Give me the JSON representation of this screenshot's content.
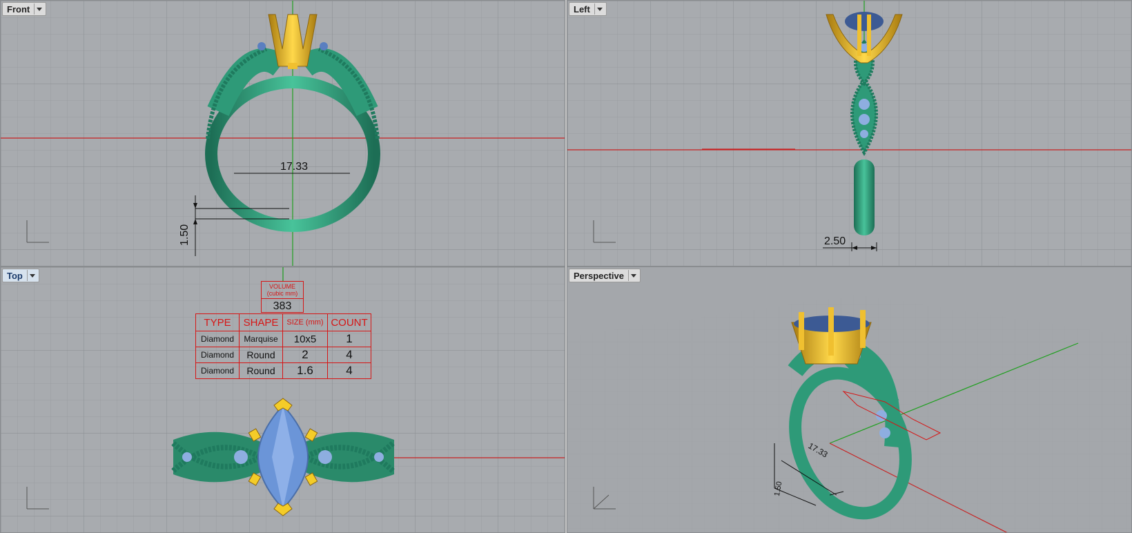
{
  "viewports": {
    "front": {
      "label": "Front"
    },
    "left": {
      "label": "Left"
    },
    "top": {
      "label": "Top"
    },
    "perspective": {
      "label": "Perspective"
    }
  },
  "dimensions": {
    "front_width": "17.33",
    "front_thickness": "1.50",
    "left_width": "2.50",
    "persp_width": "17.33",
    "persp_thickness": "1.50"
  },
  "stone_table": {
    "volume_title": "VOLUME",
    "volume_unit": "(cubic mm)",
    "volume_value": "383",
    "headers": [
      "TYPE",
      "SHAPE",
      "SIZE (mm)",
      "COUNT"
    ],
    "rows": [
      [
        "Diamond",
        "Marquise",
        "10x5",
        "1"
      ],
      [
        "Diamond",
        "Round",
        "2",
        "4"
      ],
      [
        "Diamond",
        "Round",
        "1.6",
        "4"
      ]
    ]
  },
  "colors": {
    "band": "#2e9a78",
    "prongs": "#e8b820",
    "stone": "#4a6ea8",
    "axis_x": "#c82020",
    "axis_y": "#20a020",
    "viewport_bg": "#a8abaf"
  }
}
